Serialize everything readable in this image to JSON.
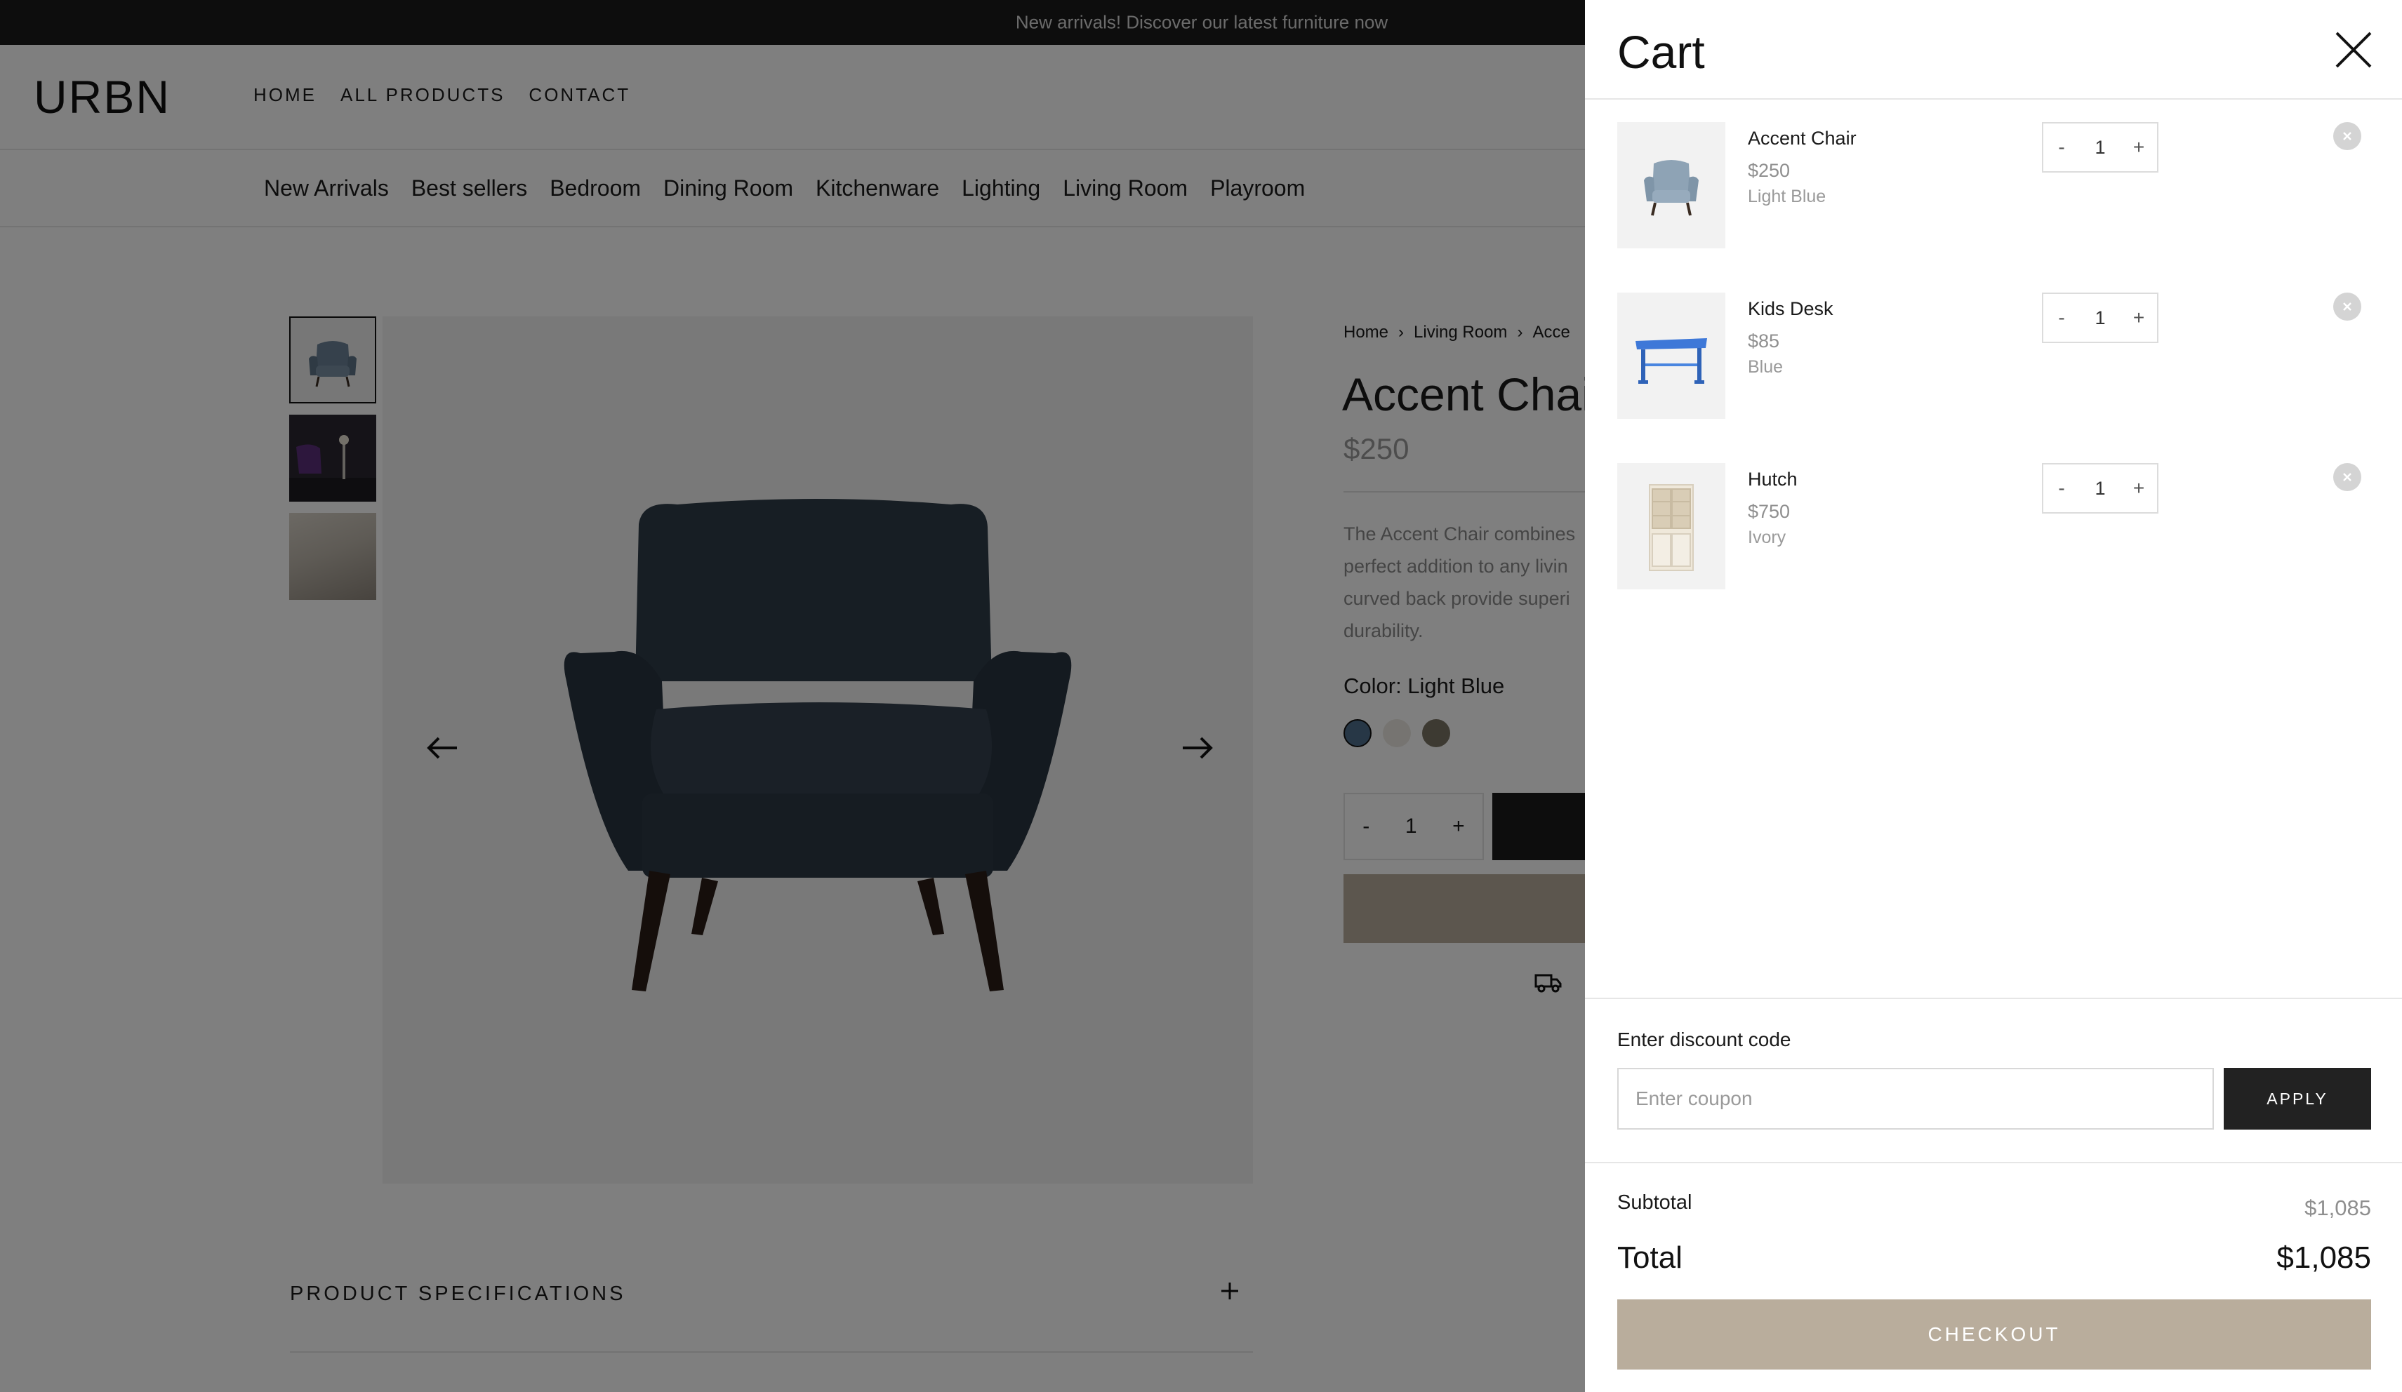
{
  "announcement": "New arrivals! Discover our latest furniture now",
  "brand": "URBN",
  "topnav": [
    "HOME",
    "ALL PRODUCTS",
    "CONTACT"
  ],
  "categories": [
    "New Arrivals",
    "Best sellers",
    "Bedroom",
    "Dining Room",
    "Kitchenware",
    "Lighting",
    "Living Room",
    "Playroom"
  ],
  "product": {
    "breadcrumb": [
      "Home",
      "Living Room",
      "Acce"
    ],
    "title": "Accent Chai",
    "price": "$250",
    "description": "The Accent Chair combines perfect addition to any livin curved back provide superi durability.",
    "color_label": "Color: Light Blue",
    "swatches": [
      "#4f6f8c",
      "#ece9e3",
      "#7b7465"
    ],
    "qty": "1",
    "qty_minus": "-",
    "qty_plus": "+",
    "specs_label": "PRODUCT SPECIFICATIONS"
  },
  "cart": {
    "title": "Cart",
    "items": [
      {
        "name": "Accent Chair",
        "price": "$250",
        "variant": "Light Blue",
        "qty": "1",
        "icon": "accent-chair"
      },
      {
        "name": "Kids Desk",
        "price": "$85",
        "variant": "Blue",
        "qty": "1",
        "icon": "kids-desk"
      },
      {
        "name": "Hutch",
        "price": "$750",
        "variant": "Ivory",
        "qty": "1",
        "icon": "hutch"
      }
    ],
    "qty_minus": "-",
    "qty_plus": "+",
    "discount_label": "Enter discount code",
    "discount_placeholder": "Enter coupon",
    "apply_label": "APPLY",
    "subtotal_label": "Subtotal",
    "subtotal_value": "$1,085",
    "total_label": "Total",
    "total_value": "$1,085",
    "checkout_label": "CHECKOUT"
  },
  "colors": {
    "announcement_bg": "#1a1a1a",
    "overlay": "rgba(0,0,0,0.5)",
    "accent_tan": "#b9ad9c",
    "apply_bg": "#222222"
  }
}
